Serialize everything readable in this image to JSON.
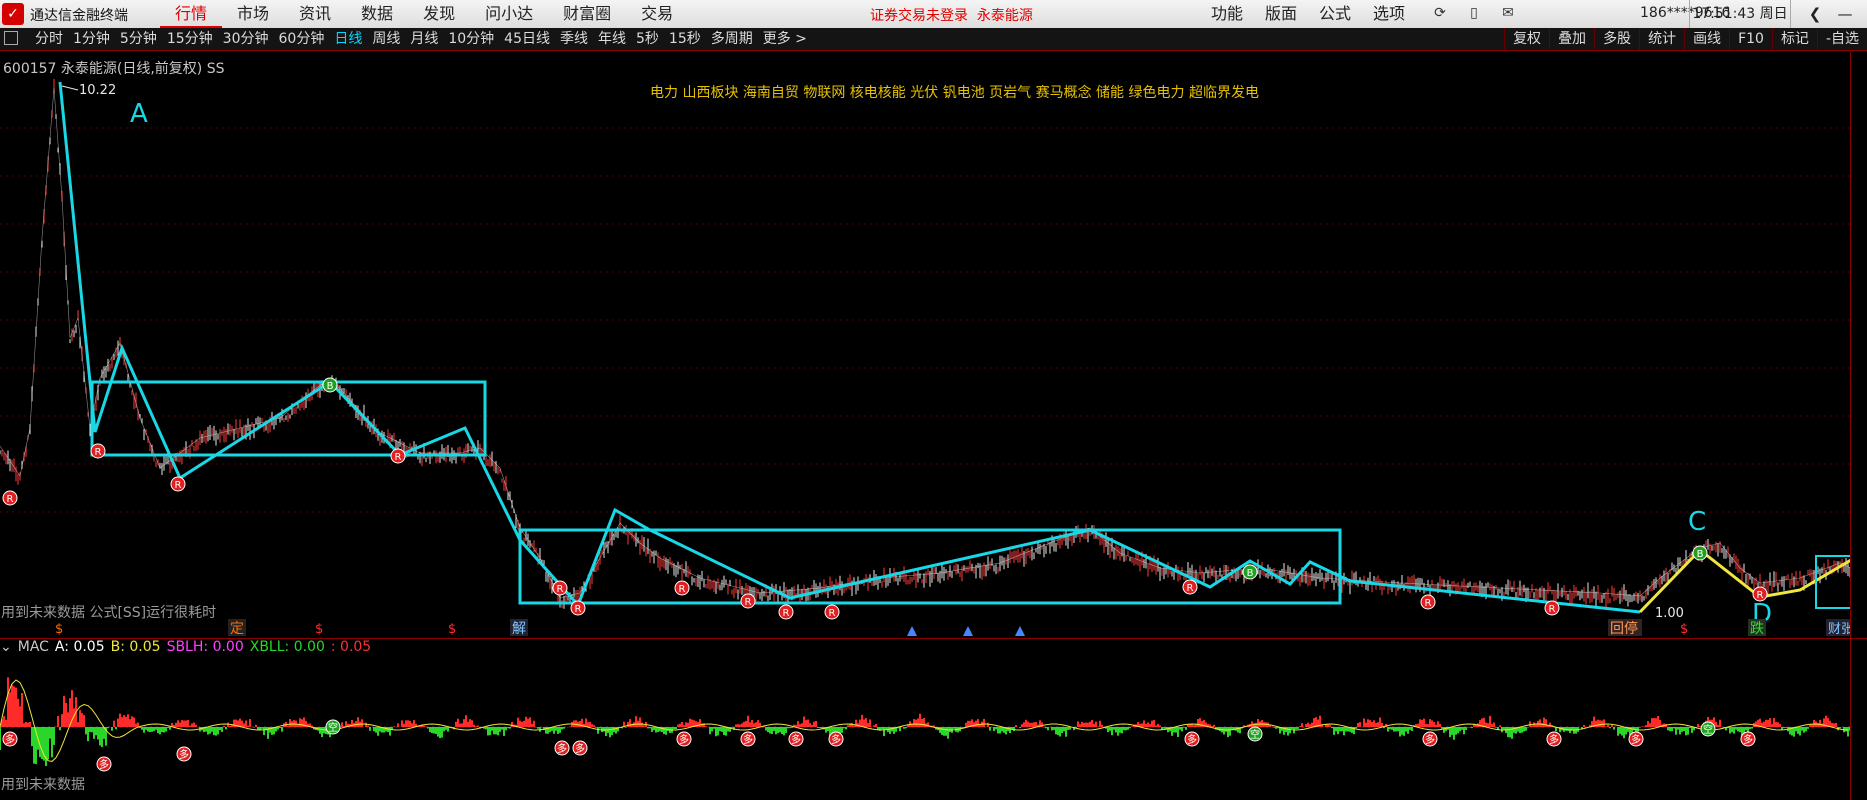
{
  "app": {
    "title": "通达信金融终端"
  },
  "nav": [
    "行情",
    "市场",
    "资讯",
    "数据",
    "发现",
    "问小达",
    "财富圈",
    "交易"
  ],
  "nav_active": 0,
  "notice": {
    "login": "证券交易未登录",
    "stock": "永泰能源"
  },
  "rmenu": [
    "功能",
    "版面",
    "公式",
    "选项"
  ],
  "user": {
    "phone": "186****9616"
  },
  "clock": "17:51:43 周日",
  "icons": [
    "refresh-icon",
    "phone-icon",
    "mail-icon"
  ],
  "periods": [
    "分时",
    "1分钟",
    "5分钟",
    "15分钟",
    "30分钟",
    "60分钟",
    "日线",
    "周线",
    "月线",
    "10分钟",
    "45日线",
    "季线",
    "年线",
    "5秒",
    "15秒",
    "多周期",
    "更多 >"
  ],
  "period_active": 6,
  "tools": [
    "复权",
    "叠加",
    "多股",
    "统计",
    "画线",
    "F10",
    "标记",
    "-自选"
  ],
  "stock": {
    "info": "600157 永泰能源(日线,前复权) SS"
  },
  "sectors": "电力 山西板块 海南自贸 物联网 核电核能 光伏 钒电池 页岩气 赛马概念 储能 绿色电力 超临界发电",
  "labels": {
    "peak": "10.22",
    "low": "1.00",
    "a": "A",
    "c": "C",
    "d": "D"
  },
  "markers": {
    "r": "R",
    "b": "B",
    "s": "$",
    "ding": "定",
    "jie": "解",
    "huiting": "回停",
    "die": "跌",
    "cai": "财张"
  },
  "warning": "用到未来数据 公式[SS]运行很耗时",
  "indicator": {
    "name": "MAC",
    "a_label": "A:",
    "a_value": "0.05",
    "b_label": "B:",
    "b_value": "0.05",
    "sblh_label": "SBLH:",
    "sblh_value": "0.00",
    "xbll_label": "XBLL:",
    "xbll_value": "0.00",
    "last_value": ": 0.05"
  },
  "sub_markers": {
    "duo": "多",
    "kong": "空"
  },
  "warning2": "用到未来数据",
  "colors": {
    "cyan": "#19d8e6",
    "yellow": "#f0e63c",
    "red": "#ff2a2a",
    "green": "#2ad62a"
  }
}
